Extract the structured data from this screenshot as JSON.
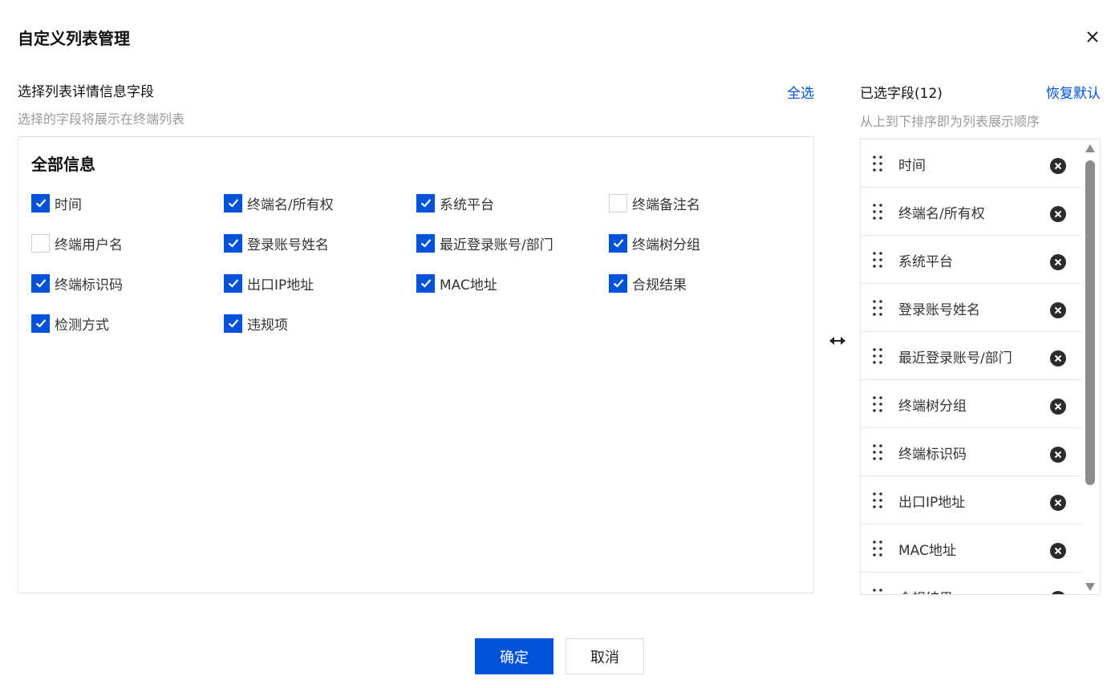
{
  "dialog": {
    "title": "自定义列表管理"
  },
  "left": {
    "title": "选择列表详情信息字段",
    "subtitle": "选择的字段将展示在终端列表",
    "select_all": "全选",
    "group_title": "全部信息",
    "fields": [
      {
        "label": "时间",
        "checked": true
      },
      {
        "label": "终端名/所有权",
        "checked": true
      },
      {
        "label": "系统平台",
        "checked": true
      },
      {
        "label": "终端备注名",
        "checked": false
      },
      {
        "label": "终端用户名",
        "checked": false
      },
      {
        "label": "登录账号姓名",
        "checked": true
      },
      {
        "label": "最近登录账号/部门",
        "checked": true
      },
      {
        "label": "终端树分组",
        "checked": true
      },
      {
        "label": "终端标识码",
        "checked": true
      },
      {
        "label": "出口IP地址",
        "checked": true
      },
      {
        "label": "MAC地址",
        "checked": true
      },
      {
        "label": "合规结果",
        "checked": true
      },
      {
        "label": "检测方式",
        "checked": true
      },
      {
        "label": "违规项",
        "checked": true
      }
    ]
  },
  "right": {
    "title": "已选字段(12)",
    "restore": "恢复默认",
    "subtitle": "从上到下排序即为列表展示顺序",
    "selected": [
      "时间",
      "终端名/所有权",
      "系统平台",
      "登录账号姓名",
      "最近登录账号/部门",
      "终端树分组",
      "终端标识码",
      "出口IP地址",
      "MAC地址",
      "合规结果"
    ]
  },
  "footer": {
    "confirm": "确定",
    "cancel": "取消"
  },
  "colors": {
    "accent": "#0052d9",
    "icon_dark": "#2b2b2b"
  },
  "icons": {
    "close": "close-icon",
    "checkmark": "checkmark-icon",
    "swap": "swap-horizontal-icon",
    "drag": "drag-handle-icon",
    "remove": "remove-circle-icon"
  }
}
